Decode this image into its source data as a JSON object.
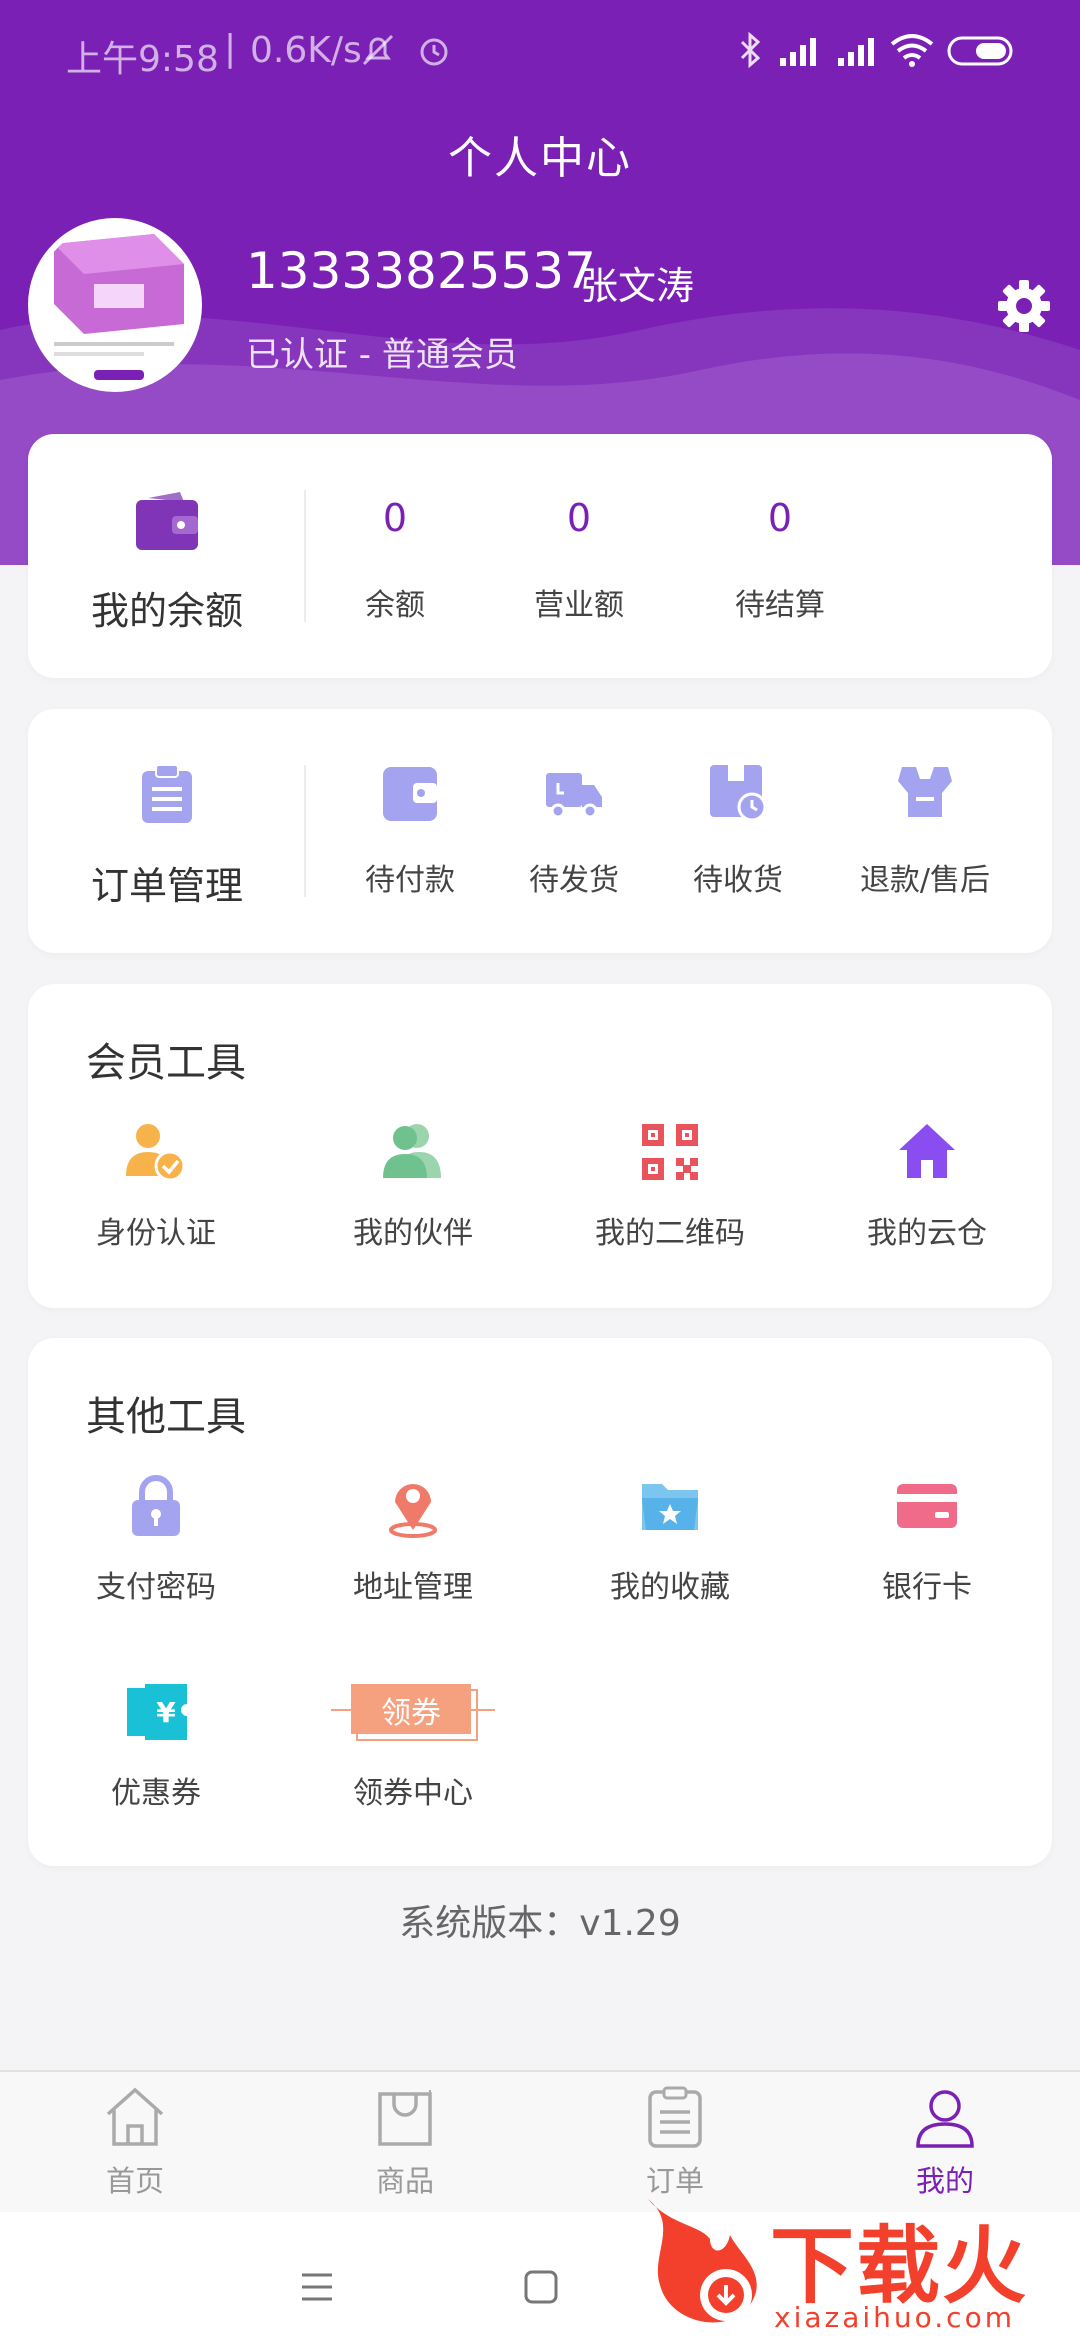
{
  "statusbar": {
    "time": "上午9:58",
    "separator": "|",
    "speed": "0.6K/s"
  },
  "page": {
    "title": "个人中心"
  },
  "profile": {
    "phone": "13333825537",
    "name": "张文涛",
    "status": "已认证 - 普通会员"
  },
  "balance": {
    "label": "我的余额",
    "items": [
      {
        "value": "0",
        "label": "余额"
      },
      {
        "value": "0",
        "label": "营业额"
      },
      {
        "value": "0",
        "label": "待结算"
      }
    ]
  },
  "orders": {
    "label": "订单管理",
    "items": [
      {
        "label": "待付款"
      },
      {
        "label": "待发货"
      },
      {
        "label": "待收货"
      },
      {
        "label": "退款/售后"
      }
    ]
  },
  "member_tools": {
    "title": "会员工具",
    "items": [
      {
        "label": "身份认证",
        "icon": "identity-verify-icon"
      },
      {
        "label": "我的伙伴",
        "icon": "partners-icon"
      },
      {
        "label": "我的二维码",
        "icon": "qrcode-icon"
      },
      {
        "label": "我的云仓",
        "icon": "home-icon"
      }
    ]
  },
  "other_tools": {
    "title": "其他工具",
    "items": [
      {
        "label": "支付密码",
        "icon": "lock-icon"
      },
      {
        "label": "地址管理",
        "icon": "location-pin-icon"
      },
      {
        "label": "我的收藏",
        "icon": "folder-star-icon"
      },
      {
        "label": "银行卡",
        "icon": "bank-card-icon"
      },
      {
        "label": "优惠券",
        "icon": "coupon-icon"
      },
      {
        "label": "领券中心",
        "icon": "coupon-center-icon",
        "badge": "领券"
      }
    ]
  },
  "version": {
    "text": "系统版本：v1.29"
  },
  "tabbar": {
    "items": [
      {
        "label": "首页",
        "icon": "home-outline-icon"
      },
      {
        "label": "商品",
        "icon": "shopping-bag-icon"
      },
      {
        "label": "订单",
        "icon": "order-list-icon"
      },
      {
        "label": "我的",
        "icon": "user-icon",
        "active": true
      }
    ]
  },
  "watermark": {
    "brand": "下载火",
    "url": "xiazaihuo.com"
  },
  "colors": {
    "brand": "#7b20b4",
    "icon_lavender": "#a3a3f0",
    "icon_orange": "#f7b24a",
    "icon_green": "#6fc28e",
    "icon_red": "#e9545c",
    "icon_purple": "#8a4df0",
    "icon_cyan": "#19c0d6",
    "icon_salmon": "#f68b6a"
  }
}
